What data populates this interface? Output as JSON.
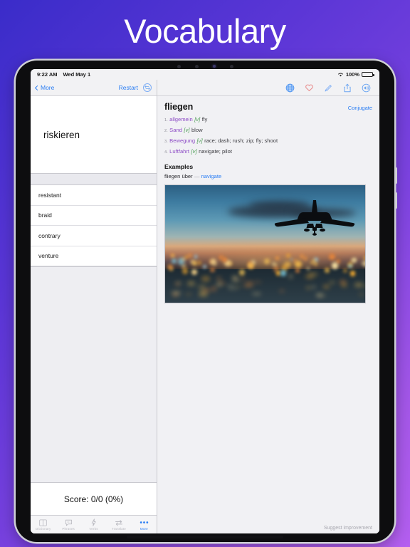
{
  "promo": {
    "title": "Vocabulary"
  },
  "status_bar": {
    "time": "9:22 AM",
    "date": "Wed May 1",
    "wifi_icon": "wifi-icon",
    "battery_percent": "100%",
    "battery_icon": "battery-full-icon"
  },
  "left_nav": {
    "back_label": "More",
    "back_icon": "chevron-left-icon",
    "restart_label": "Restart",
    "swap_icon": "swap-languages-icon"
  },
  "flashcard": {
    "word": "riskieren"
  },
  "word_list": [
    {
      "label": "resistant"
    },
    {
      "label": "braid"
    },
    {
      "label": "contrary"
    },
    {
      "label": "venture"
    }
  ],
  "score": {
    "text": "Score: 0/0 (0%)"
  },
  "tabs": [
    {
      "label": "Dictionary",
      "icon": "book-icon",
      "active": false
    },
    {
      "label": "Phrases",
      "icon": "speech-bubble-icon",
      "active": false
    },
    {
      "label": "Verbs",
      "icon": "lightning-bolt-icon",
      "active": false
    },
    {
      "label": "Translate",
      "icon": "translate-arrows-icon",
      "active": false
    },
    {
      "label": "More",
      "icon": "ellipsis-icon",
      "active": true
    }
  ],
  "right_toolbar": {
    "icons": [
      {
        "name": "globe-icon",
        "color": "#5a9bf0"
      },
      {
        "name": "heart-icon",
        "color": "#e88b8b"
      },
      {
        "name": "pencil-icon",
        "color": "#7eaef5"
      },
      {
        "name": "share-icon",
        "color": "#6aa5f2"
      },
      {
        "name": "speaker-icon",
        "color": "#6aa5f2"
      }
    ]
  },
  "entry": {
    "headword": "fliegen",
    "conjugate_label": "Conjugate",
    "senses": [
      {
        "num": "1.",
        "domain": "allgemein",
        "pos": "[v]",
        "gloss": "fly"
      },
      {
        "num": "2.",
        "domain": "Sand",
        "pos": "[v]",
        "gloss": "blow"
      },
      {
        "num": "3.",
        "domain": "Bewegung",
        "pos": "[v]",
        "gloss": "race; dash; rush; zip; fly; shoot"
      },
      {
        "num": "4.",
        "domain": "Luftfahrt",
        "pos": "[v]",
        "gloss": "navigate; pilot"
      }
    ],
    "examples_title": "Examples",
    "example": {
      "source": "fliegen über",
      "dash": "—",
      "translation": "navigate"
    },
    "image_alt": "airplane-silhouette-over-city-lights-at-dusk"
  },
  "footer": {
    "suggest_label": "Suggest improvement"
  },
  "colors": {
    "accent_blue": "#2b7ef3",
    "domain_purple": "#8e4ec6",
    "pos_green": "#4a9c52",
    "heart_red": "#e88b8b",
    "bg_gradient_start": "#3a2cc9",
    "bg_gradient_end": "#b45ff0"
  }
}
